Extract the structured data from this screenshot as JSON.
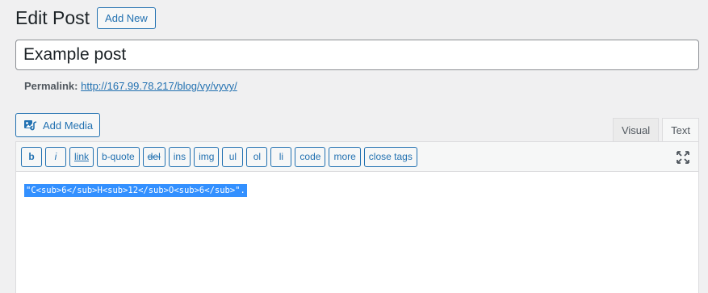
{
  "header": {
    "title": "Edit Post",
    "add_new_label": "Add New"
  },
  "post": {
    "title_value": "Example post"
  },
  "permalink": {
    "label": "Permalink:",
    "url": "http://167.99.78.217/blog/vy/vyvy/"
  },
  "media": {
    "add_media_label": "Add Media"
  },
  "editor_tabs": {
    "visual_label": "Visual",
    "text_label": "Text",
    "active": "Text"
  },
  "quicktags": [
    {
      "label": "b"
    },
    {
      "label": "i"
    },
    {
      "label": "link"
    },
    {
      "label": "b-quote"
    },
    {
      "label": "del"
    },
    {
      "label": "ins"
    },
    {
      "label": "img"
    },
    {
      "label": "ul"
    },
    {
      "label": "ol"
    },
    {
      "label": "li"
    },
    {
      "label": "code"
    },
    {
      "label": "more"
    },
    {
      "label": "close tags"
    }
  ],
  "content": {
    "text": "\"C<sub>6</sub>H<sub>12</sub>O<sub>6</sub>\"."
  },
  "colors": {
    "accent": "#2271b1",
    "selection": "#3390ff",
    "background": "#f0f0f1"
  }
}
